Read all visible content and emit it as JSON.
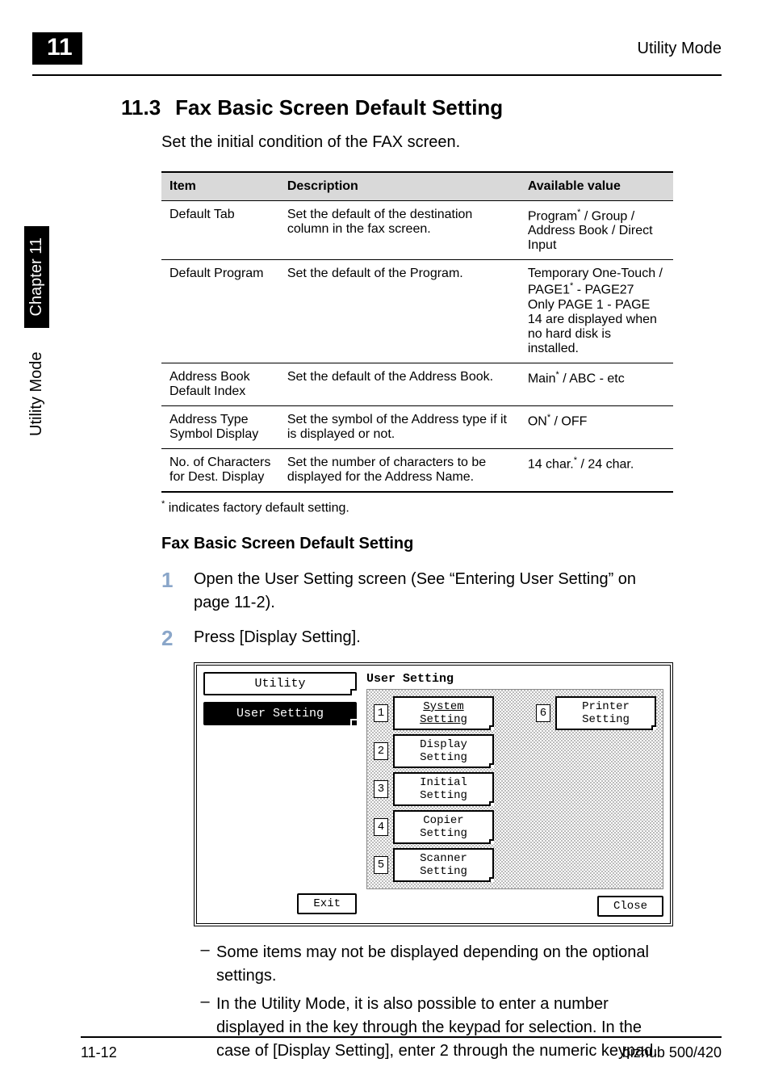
{
  "header": {
    "chapter_badge": "11",
    "mode_label": "Utility Mode"
  },
  "section": {
    "number": "11.3",
    "title": "Fax Basic Screen Default Setting",
    "intro": "Set the initial condition of the FAX screen."
  },
  "table": {
    "head": {
      "item": "Item",
      "description": "Description",
      "available": "Available value"
    },
    "rows": [
      {
        "item": "Default Tab",
        "desc": "Set the default of the destination column in the fax screen.",
        "avail_prefix": "Program",
        "avail_suffix": " / Group / Address Book / Direct Input"
      },
      {
        "item": "Default Program",
        "desc": "Set the default of the Program.",
        "avail_prefix": "Temporary One-Touch / PAGE1",
        "avail_suffix": " - PAGE27\nOnly PAGE 1 - PAGE 14 are displayed when no hard disk is installed."
      },
      {
        "item": "Address Book Default Index",
        "desc": "Set the default of the Address Book.",
        "avail_prefix": "Main",
        "avail_suffix": " / ABC - etc"
      },
      {
        "item": "Address Type Symbol Display",
        "desc": "Set the symbol of the Address type if it is displayed or not.",
        "avail_prefix": "ON",
        "avail_suffix": " / OFF"
      },
      {
        "item": "No. of Characters for Dest. Display",
        "desc": "Set the number of characters to be displayed for the Address Name.",
        "avail_prefix": "14 char.",
        "avail_suffix": " / 24 char."
      }
    ]
  },
  "footnote": {
    "marker": "*",
    "text": " indicates factory default setting."
  },
  "subheading": "Fax Basic Screen Default Setting",
  "steps": {
    "s1": {
      "num": "1",
      "text": "Open the User Setting screen (See “Entering User Setting” on page 11-2)."
    },
    "s2": {
      "num": "2",
      "text": "Press [Display Setting]."
    }
  },
  "screenshot": {
    "left_tab1": "Utility",
    "left_tab2": "User Setting",
    "panel_title": "User Setting",
    "buttons": {
      "b1": {
        "n": "1",
        "label": "System Setting"
      },
      "b2": {
        "n": "2",
        "label": "Display Setting"
      },
      "b3": {
        "n": "3",
        "label": "Initial Setting"
      },
      "b4": {
        "n": "4",
        "label": "Copier Setting"
      },
      "b5": {
        "n": "5",
        "label": "Scanner Setting"
      },
      "b6": {
        "n": "6",
        "label": "Printer Setting"
      }
    },
    "exit": "Exit",
    "close": "Close"
  },
  "bullets": {
    "b1": "Some items may not be displayed depending on the optional settings.",
    "b2": "In the Utility Mode, it is also possible to enter a number displayed in the key through the keypad for selection. In the case of [Display Setting], enter 2 through the numeric keypad."
  },
  "side": {
    "label": "Utility Mode",
    "chapter": "Chapter 11"
  },
  "footer": {
    "page": "11-12",
    "product": "bizhub 500/420"
  }
}
